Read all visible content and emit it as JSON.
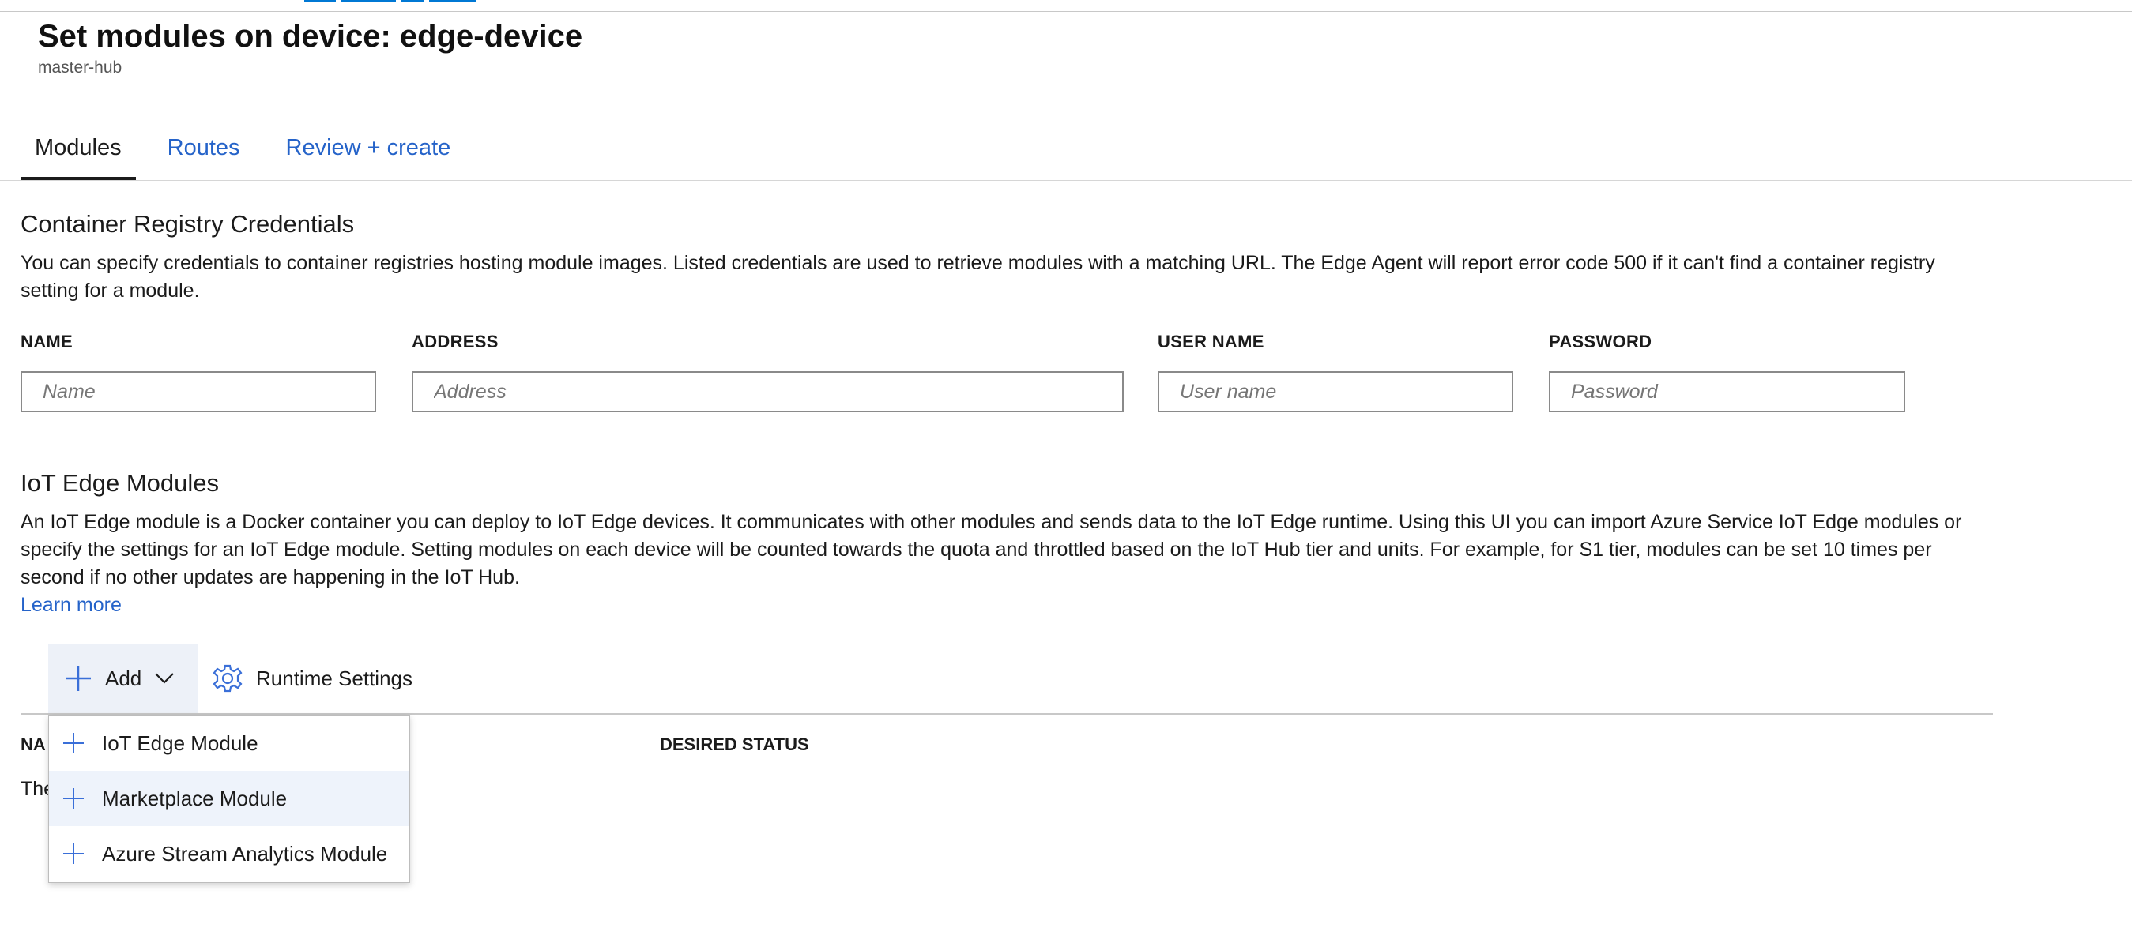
{
  "header": {
    "title": "Set modules on device: edge-device",
    "subtitle": "master-hub"
  },
  "tabs": [
    {
      "label": "Modules",
      "active": true
    },
    {
      "label": "Routes",
      "active": false
    },
    {
      "label": "Review + create",
      "active": false
    }
  ],
  "registry": {
    "title": "Container Registry Credentials",
    "description": "You can specify credentials to container registries hosting module images. Listed credentials are used to retrieve modules with a matching URL. The Edge Agent will report error code 500 if it can't find a container registry setting for a module.",
    "fields": {
      "name": {
        "label": "NAME",
        "placeholder": "Name",
        "value": ""
      },
      "address": {
        "label": "ADDRESS",
        "placeholder": "Address",
        "value": ""
      },
      "username": {
        "label": "USER NAME",
        "placeholder": "User name",
        "value": ""
      },
      "password": {
        "label": "PASSWORD",
        "placeholder": "Password",
        "value": ""
      }
    }
  },
  "modules": {
    "title": "IoT Edge Modules",
    "description": "An IoT Edge module is a Docker container you can deploy to IoT Edge devices. It communicates with other modules and sends data to the IoT Edge runtime. Using this UI you can import Azure Service IoT Edge modules or specify the settings for an IoT Edge module. Setting modules on each device will be counted towards the quota and throttled based on the IoT Hub tier and units. For example, for S1 tier, modules can be set 10 times per second if no other updates are happening in the IoT Hub.",
    "learn_more": "Learn more",
    "toolbar": {
      "add_label": "Add",
      "runtime_label": "Runtime Settings"
    },
    "table": {
      "col_name": "NA",
      "col_status": "DESIRED STATUS",
      "empty_text": "The"
    },
    "add_menu": [
      {
        "label": "IoT Edge Module",
        "icon": "plus-icon"
      },
      {
        "label": "Marketplace Module",
        "icon": "plus-icon",
        "highlighted": true
      },
      {
        "label": "Azure Stream Analytics Module",
        "icon": "plus-icon"
      }
    ]
  },
  "colors": {
    "link": "#2563c9",
    "icon_accent": "#3a6fd8",
    "hover_bg": "#eef3fb",
    "add_button_bg": "#edf1f8"
  }
}
